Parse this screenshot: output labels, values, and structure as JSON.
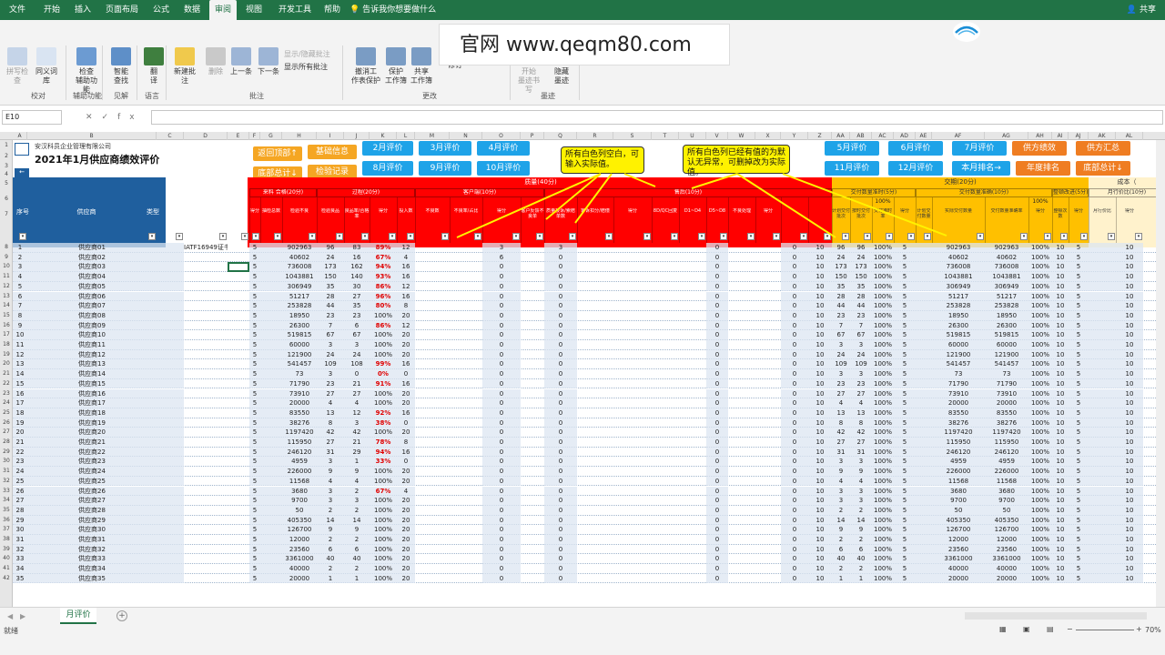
{
  "ribbon": {
    "tabs": [
      "文件",
      "开始",
      "插入",
      "页面布局",
      "公式",
      "数据",
      "审阅",
      "视图",
      "开发工具",
      "帮助"
    ],
    "active_tab": "审阅",
    "tell_me": "告诉我你想要做什么",
    "share": "共享",
    "buttons": {
      "spell": "拼写检查",
      "thesaurus": "同义词库",
      "check_assist": "检查\n辅助功能",
      "smart_lookup": "智能\n查找",
      "translate": "翻\n译",
      "new_comment": "新建批注",
      "delete": "删除",
      "prev": "上一条",
      "next": "下一条",
      "show_hide": "显示/隐藏批注",
      "show_all": "显示所有批注",
      "unprotect": "撤消工\n作表保护",
      "protect_wb": "保护\n工作簿",
      "share_wb": "共享\n工作簿",
      "allow_edit": "允许用户编辑区域",
      "track": "修订",
      "start_ink": "开始\n墨迹书写",
      "hide_ink": "隐藏\n墨迹"
    },
    "groups": {
      "proofing": "校对",
      "accessibility": "辅助功能",
      "insights": "见解",
      "language": "语言",
      "comments": "批注",
      "changes": "更改",
      "ink": "墨迹"
    }
  },
  "watermark": "官网  www.qeqm80.com",
  "formula_bar": {
    "name_box": "E10",
    "fx": "fx"
  },
  "columns": [
    "A",
    "B",
    "C",
    "D",
    "E",
    "F",
    "G",
    "H",
    "I",
    "J",
    "K",
    "L",
    "M",
    "N",
    "O",
    "P",
    "Q",
    "R",
    "S",
    "T",
    "U",
    "V",
    "W",
    "X",
    "Y",
    "Z",
    "AA",
    "AB",
    "AC",
    "AD",
    "AE",
    "AF",
    "AG",
    "AH",
    "AI",
    "AJ",
    "AK",
    "AL"
  ],
  "sheet": {
    "company": "安汉科员企业管理有限公司",
    "title": "2021年1月供应商绩效评价",
    "buttons_orange": [
      "返回顶部↑",
      "基础信息",
      "底部总计↓",
      "检验记录"
    ],
    "buttons_blue_left": [
      "2月评价",
      "3月评价",
      "4月评价",
      "8月评价",
      "9月评价",
      "10月评价"
    ],
    "buttons_blue_right": [
      "5月评价",
      "6月评价",
      "7月评价",
      "11月评价",
      "12月评价",
      "本月排名→"
    ],
    "buttons_orange_right": [
      "供方绩效",
      "供方汇总",
      "年度排名",
      "底部总计↓"
    ],
    "note1": "所有白色列空白，可输入实际值。",
    "note2": "所有白色列已经有值的为默认无异常，可删掉改为实际值。",
    "hdr_seq": "序号",
    "hdr_supplier": "供应商",
    "hdr_type": "类型",
    "hdr_quality": "质量(40分)",
    "hdr_delivery": "交期(20分)",
    "hdr_cost": "成本（",
    "sub_a": "来料 合格(20分)",
    "sub_b": "过程(20分)",
    "sub_c": "客户端(10分)",
    "sub_d": "售后(10分)",
    "sub_e": "交付数量准时(5分)",
    "sub_f": "交付数量准确(10分)",
    "sub_g": "整顿改进(5分)",
    "sub_h": "月行价比(10分)",
    "hdr_pct1": "100%",
    "hdr_pct2": "100%",
    "r6_cols": [
      "来料批次",
      "来料合格批",
      "得分",
      "抽检总数",
      "检验不良",
      "检验良品",
      "良品率/合格率",
      "得分",
      "投入数",
      "不良数",
      "不良率/占比",
      "得分",
      "客户反馈不良单",
      "质量投诉/索赔单数",
      "客诉扣分/赔偿",
      "得分",
      "8D/QC回复",
      "D1~D4",
      "D5~D8",
      "不良处理",
      "得分",
      "",
      "",
      "计划交付批次",
      "按时交付批次",
      "交付准时率",
      "得分",
      "计划交付数量",
      "实际交付数量",
      "交付数量准确率",
      "得分",
      "整顿次数",
      "得分",
      "月行价比",
      "得分"
    ],
    "rows": [
      {
        "n": "1",
        "name": "供应商01",
        "d": "IATF16949证书",
        "h": "902963",
        "i": "96",
        "j": "83",
        "k": "89%",
        "l": "12",
        "o": "3",
        "q": "3",
        "v": "0",
        "y": "0",
        "z": "10",
        "aa": "96",
        "ab": "96",
        "ac": "100%",
        "ad": "5",
        "ae": "902963",
        "af": "902963",
        "ag": "100%",
        "ah": "10",
        "aj": "5",
        "al": "10"
      },
      {
        "n": "2",
        "name": "供应商02",
        "h": "40602",
        "i": "24",
        "j": "16",
        "k": "67%",
        "l": "4",
        "o": "6",
        "q": "0",
        "v": "0",
        "y": "0",
        "z": "10",
        "aa": "24",
        "ab": "24",
        "ac": "100%",
        "ad": "5",
        "ae": "40602",
        "af": "40602",
        "ag": "100%",
        "ah": "10",
        "aj": "5",
        "al": "10"
      },
      {
        "n": "3",
        "name": "供应商03",
        "h": "736008",
        "i": "173",
        "j": "162",
        "k": "94%",
        "l": "16",
        "o": "0",
        "q": "0",
        "v": "0",
        "y": "0",
        "z": "10",
        "aa": "173",
        "ab": "173",
        "ac": "100%",
        "ad": "5",
        "ae": "736008",
        "af": "736008",
        "ag": "100%",
        "ah": "10",
        "aj": "5",
        "al": "10"
      },
      {
        "n": "4",
        "name": "供应商04",
        "h": "1043881",
        "i": "150",
        "j": "140",
        "k": "93%",
        "l": "16",
        "o": "0",
        "q": "0",
        "v": "0",
        "y": "0",
        "z": "10",
        "aa": "150",
        "ab": "150",
        "ac": "100%",
        "ad": "5",
        "ae": "1043881",
        "af": "1043881",
        "ag": "100%",
        "ah": "10",
        "aj": "5",
        "al": "10"
      },
      {
        "n": "5",
        "name": "供应商05",
        "h": "306949",
        "i": "35",
        "j": "30",
        "k": "86%",
        "l": "12",
        "o": "0",
        "q": "0",
        "v": "0",
        "y": "0",
        "z": "10",
        "aa": "35",
        "ab": "35",
        "ac": "100%",
        "ad": "5",
        "ae": "306949",
        "af": "306949",
        "ag": "100%",
        "ah": "10",
        "aj": "5",
        "al": "10"
      },
      {
        "n": "6",
        "name": "供应商06",
        "h": "51217",
        "i": "28",
        "j": "27",
        "k": "96%",
        "l": "16",
        "o": "0",
        "q": "0",
        "v": "0",
        "y": "0",
        "z": "10",
        "aa": "28",
        "ab": "28",
        "ac": "100%",
        "ad": "5",
        "ae": "51217",
        "af": "51217",
        "ag": "100%",
        "ah": "10",
        "aj": "5",
        "al": "10"
      },
      {
        "n": "7",
        "name": "供应商07",
        "h": "253828",
        "i": "44",
        "j": "35",
        "k": "80%",
        "l": "8",
        "o": "0",
        "q": "0",
        "v": "0",
        "y": "0",
        "z": "10",
        "aa": "44",
        "ab": "44",
        "ac": "100%",
        "ad": "5",
        "ae": "253828",
        "af": "253828",
        "ag": "100%",
        "ah": "10",
        "aj": "5",
        "al": "10"
      },
      {
        "n": "8",
        "name": "供应商08",
        "h": "18950",
        "i": "23",
        "j": "23",
        "k": "100%",
        "l": "20",
        "o": "0",
        "q": "0",
        "v": "0",
        "y": "0",
        "z": "10",
        "aa": "23",
        "ab": "23",
        "ac": "100%",
        "ad": "5",
        "ae": "18950",
        "af": "18950",
        "ag": "100%",
        "ah": "10",
        "aj": "5",
        "al": "10"
      },
      {
        "n": "9",
        "name": "供应商09",
        "h": "26300",
        "i": "7",
        "j": "6",
        "k": "86%",
        "l": "12",
        "o": "0",
        "q": "0",
        "v": "0",
        "y": "0",
        "z": "10",
        "aa": "7",
        "ab": "7",
        "ac": "100%",
        "ad": "5",
        "ae": "26300",
        "af": "26300",
        "ag": "100%",
        "ah": "10",
        "aj": "5",
        "al": "10"
      },
      {
        "n": "10",
        "name": "供应商10",
        "h": "519815",
        "i": "67",
        "j": "67",
        "k": "100%",
        "l": "20",
        "o": "0",
        "q": "0",
        "v": "0",
        "y": "0",
        "z": "10",
        "aa": "67",
        "ab": "67",
        "ac": "100%",
        "ad": "5",
        "ae": "519815",
        "af": "519815",
        "ag": "100%",
        "ah": "10",
        "aj": "5",
        "al": "10"
      },
      {
        "n": "11",
        "name": "供应商11",
        "h": "60000",
        "i": "3",
        "j": "3",
        "k": "100%",
        "l": "20",
        "o": "0",
        "q": "0",
        "v": "0",
        "y": "0",
        "z": "10",
        "aa": "3",
        "ab": "3",
        "ac": "100%",
        "ad": "5",
        "ae": "60000",
        "af": "60000",
        "ag": "100%",
        "ah": "10",
        "aj": "5",
        "al": "10"
      },
      {
        "n": "12",
        "name": "供应商12",
        "h": "121900",
        "i": "24",
        "j": "24",
        "k": "100%",
        "l": "20",
        "o": "0",
        "q": "0",
        "v": "0",
        "y": "0",
        "z": "10",
        "aa": "24",
        "ab": "24",
        "ac": "100%",
        "ad": "5",
        "ae": "121900",
        "af": "121900",
        "ag": "100%",
        "ah": "10",
        "aj": "5",
        "al": "10"
      },
      {
        "n": "13",
        "name": "供应商13",
        "h": "541457",
        "i": "109",
        "j": "108",
        "k": "99%",
        "l": "16",
        "o": "0",
        "q": "0",
        "v": "0",
        "y": "0",
        "z": "10",
        "aa": "109",
        "ab": "109",
        "ac": "100%",
        "ad": "5",
        "ae": "541457",
        "af": "541457",
        "ag": "100%",
        "ah": "10",
        "aj": "5",
        "al": "10"
      },
      {
        "n": "14",
        "name": "供应商14",
        "h": "73",
        "i": "3",
        "j": "0",
        "k": "0%",
        "l": "0",
        "o": "0",
        "q": "0",
        "v": "0",
        "y": "0",
        "z": "10",
        "aa": "3",
        "ab": "3",
        "ac": "100%",
        "ad": "5",
        "ae": "73",
        "af": "73",
        "ag": "100%",
        "ah": "10",
        "aj": "5",
        "al": "10"
      },
      {
        "n": "15",
        "name": "供应商15",
        "h": "71790",
        "i": "23",
        "j": "21",
        "k": "91%",
        "l": "16",
        "o": "0",
        "q": "0",
        "v": "0",
        "y": "0",
        "z": "10",
        "aa": "23",
        "ab": "23",
        "ac": "100%",
        "ad": "5",
        "ae": "71790",
        "af": "71790",
        "ag": "100%",
        "ah": "10",
        "aj": "5",
        "al": "10"
      },
      {
        "n": "16",
        "name": "供应商16",
        "h": "73910",
        "i": "27",
        "j": "27",
        "k": "100%",
        "l": "20",
        "o": "0",
        "q": "0",
        "v": "0",
        "y": "0",
        "z": "10",
        "aa": "27",
        "ab": "27",
        "ac": "100%",
        "ad": "5",
        "ae": "73910",
        "af": "73910",
        "ag": "100%",
        "ah": "10",
        "aj": "5",
        "al": "10"
      },
      {
        "n": "17",
        "name": "供应商17",
        "h": "20000",
        "i": "4",
        "j": "4",
        "k": "100%",
        "l": "20",
        "o": "0",
        "q": "0",
        "v": "0",
        "y": "0",
        "z": "10",
        "aa": "4",
        "ab": "4",
        "ac": "100%",
        "ad": "5",
        "ae": "20000",
        "af": "20000",
        "ag": "100%",
        "ah": "10",
        "aj": "5",
        "al": "10"
      },
      {
        "n": "18",
        "name": "供应商18",
        "h": "83550",
        "i": "13",
        "j": "12",
        "k": "92%",
        "l": "16",
        "o": "0",
        "q": "0",
        "v": "0",
        "y": "0",
        "z": "10",
        "aa": "13",
        "ab": "13",
        "ac": "100%",
        "ad": "5",
        "ae": "83550",
        "af": "83550",
        "ag": "100%",
        "ah": "10",
        "aj": "5",
        "al": "10"
      },
      {
        "n": "19",
        "name": "供应商19",
        "h": "38276",
        "i": "8",
        "j": "3",
        "k": "38%",
        "l": "0",
        "o": "0",
        "q": "0",
        "v": "0",
        "y": "0",
        "z": "10",
        "aa": "8",
        "ab": "8",
        "ac": "100%",
        "ad": "5",
        "ae": "38276",
        "af": "38276",
        "ag": "100%",
        "ah": "10",
        "aj": "5",
        "al": "10"
      },
      {
        "n": "20",
        "name": "供应商20",
        "h": "1197420",
        "i": "42",
        "j": "42",
        "k": "100%",
        "l": "20",
        "o": "0",
        "q": "0",
        "v": "0",
        "y": "0",
        "z": "10",
        "aa": "42",
        "ab": "42",
        "ac": "100%",
        "ad": "5",
        "ae": "1197420",
        "af": "1197420",
        "ag": "100%",
        "ah": "10",
        "aj": "5",
        "al": "10"
      },
      {
        "n": "21",
        "name": "供应商21",
        "h": "115950",
        "i": "27",
        "j": "21",
        "k": "78%",
        "l": "8",
        "o": "0",
        "q": "0",
        "v": "0",
        "y": "0",
        "z": "10",
        "aa": "27",
        "ab": "27",
        "ac": "100%",
        "ad": "5",
        "ae": "115950",
        "af": "115950",
        "ag": "100%",
        "ah": "10",
        "aj": "5",
        "al": "10"
      },
      {
        "n": "22",
        "name": "供应商22",
        "h": "246120",
        "i": "31",
        "j": "29",
        "k": "94%",
        "l": "16",
        "o": "0",
        "q": "0",
        "v": "0",
        "y": "0",
        "z": "10",
        "aa": "31",
        "ab": "31",
        "ac": "100%",
        "ad": "5",
        "ae": "246120",
        "af": "246120",
        "ag": "100%",
        "ah": "10",
        "aj": "5",
        "al": "10"
      },
      {
        "n": "23",
        "name": "供应商23",
        "h": "4959",
        "i": "3",
        "j": "1",
        "k": "33%",
        "l": "0",
        "o": "0",
        "q": "0",
        "v": "0",
        "y": "0",
        "z": "10",
        "aa": "3",
        "ab": "3",
        "ac": "100%",
        "ad": "5",
        "ae": "4959",
        "af": "4959",
        "ag": "100%",
        "ah": "10",
        "aj": "5",
        "al": "10"
      },
      {
        "n": "24",
        "name": "供应商24",
        "h": "226000",
        "i": "9",
        "j": "9",
        "k": "100%",
        "l": "20",
        "o": "0",
        "q": "0",
        "v": "0",
        "y": "0",
        "z": "10",
        "aa": "9",
        "ab": "9",
        "ac": "100%",
        "ad": "5",
        "ae": "226000",
        "af": "226000",
        "ag": "100%",
        "ah": "10",
        "aj": "5",
        "al": "10"
      },
      {
        "n": "25",
        "name": "供应商25",
        "h": "11568",
        "i": "4",
        "j": "4",
        "k": "100%",
        "l": "20",
        "o": "0",
        "q": "0",
        "v": "0",
        "y": "0",
        "z": "10",
        "aa": "4",
        "ab": "4",
        "ac": "100%",
        "ad": "5",
        "ae": "11568",
        "af": "11568",
        "ag": "100%",
        "ah": "10",
        "aj": "5",
        "al": "10"
      },
      {
        "n": "26",
        "name": "供应商26",
        "h": "3680",
        "i": "3",
        "j": "2",
        "k": "67%",
        "l": "4",
        "o": "0",
        "q": "0",
        "v": "0",
        "y": "0",
        "z": "10",
        "aa": "3",
        "ab": "3",
        "ac": "100%",
        "ad": "5",
        "ae": "3680",
        "af": "3680",
        "ag": "100%",
        "ah": "10",
        "aj": "5",
        "al": "10"
      },
      {
        "n": "27",
        "name": "供应商27",
        "h": "9700",
        "i": "3",
        "j": "3",
        "k": "100%",
        "l": "20",
        "o": "0",
        "q": "0",
        "v": "0",
        "y": "0",
        "z": "10",
        "aa": "3",
        "ab": "3",
        "ac": "100%",
        "ad": "5",
        "ae": "9700",
        "af": "9700",
        "ag": "100%",
        "ah": "10",
        "aj": "5",
        "al": "10"
      },
      {
        "n": "28",
        "name": "供应商28",
        "h": "50",
        "i": "2",
        "j": "2",
        "k": "100%",
        "l": "20",
        "o": "0",
        "q": "0",
        "v": "0",
        "y": "0",
        "z": "10",
        "aa": "2",
        "ab": "2",
        "ac": "100%",
        "ad": "5",
        "ae": "50",
        "af": "50",
        "ag": "100%",
        "ah": "10",
        "aj": "5",
        "al": "10"
      },
      {
        "n": "29",
        "name": "供应商29",
        "h": "405350",
        "i": "14",
        "j": "14",
        "k": "100%",
        "l": "20",
        "o": "0",
        "q": "0",
        "v": "0",
        "y": "0",
        "z": "10",
        "aa": "14",
        "ab": "14",
        "ac": "100%",
        "ad": "5",
        "ae": "405350",
        "af": "405350",
        "ag": "100%",
        "ah": "10",
        "aj": "5",
        "al": "10"
      },
      {
        "n": "30",
        "name": "供应商30",
        "h": "126700",
        "i": "9",
        "j": "9",
        "k": "100%",
        "l": "20",
        "o": "0",
        "q": "0",
        "v": "0",
        "y": "0",
        "z": "10",
        "aa": "9",
        "ab": "9",
        "ac": "100%",
        "ad": "5",
        "ae": "126700",
        "af": "126700",
        "ag": "100%",
        "ah": "10",
        "aj": "5",
        "al": "10"
      },
      {
        "n": "31",
        "name": "供应商31",
        "h": "12000",
        "i": "2",
        "j": "2",
        "k": "100%",
        "l": "20",
        "o": "0",
        "q": "0",
        "v": "0",
        "y": "0",
        "z": "10",
        "aa": "2",
        "ab": "2",
        "ac": "100%",
        "ad": "5",
        "ae": "12000",
        "af": "12000",
        "ag": "100%",
        "ah": "10",
        "aj": "5",
        "al": "10"
      },
      {
        "n": "32",
        "name": "供应商32",
        "h": "23560",
        "i": "6",
        "j": "6",
        "k": "100%",
        "l": "20",
        "o": "0",
        "q": "0",
        "v": "0",
        "y": "0",
        "z": "10",
        "aa": "6",
        "ab": "6",
        "ac": "100%",
        "ad": "5",
        "ae": "23560",
        "af": "23560",
        "ag": "100%",
        "ah": "10",
        "aj": "5",
        "al": "10"
      },
      {
        "n": "33",
        "name": "供应商33",
        "h": "3361000",
        "i": "40",
        "j": "40",
        "k": "100%",
        "l": "20",
        "o": "0",
        "q": "0",
        "v": "0",
        "y": "0",
        "z": "10",
        "aa": "40",
        "ab": "40",
        "ac": "100%",
        "ad": "5",
        "ae": "3361000",
        "af": "3361000",
        "ag": "100%",
        "ah": "10",
        "aj": "5",
        "al": "10"
      },
      {
        "n": "34",
        "name": "供应商34",
        "h": "40000",
        "i": "2",
        "j": "2",
        "k": "100%",
        "l": "20",
        "o": "0",
        "q": "0",
        "v": "0",
        "y": "0",
        "z": "10",
        "aa": "2",
        "ab": "2",
        "ac": "100%",
        "ad": "5",
        "ae": "40000",
        "af": "40000",
        "ag": "100%",
        "ah": "10",
        "aj": "5",
        "al": "10"
      },
      {
        "n": "35",
        "name": "供应商35",
        "h": "20000",
        "i": "1",
        "j": "1",
        "k": "100%",
        "l": "20",
        "o": "0",
        "q": "0",
        "v": "0",
        "y": "0",
        "z": "10",
        "aa": "1",
        "ab": "1",
        "ac": "100%",
        "ad": "5",
        "ae": "20000",
        "af": "20000",
        "ag": "100%",
        "ah": "10",
        "aj": "5",
        "al": "10"
      }
    ]
  },
  "sheet_tab": "月评价",
  "status": {
    "ready": "就绪",
    "zoom": "70%"
  },
  "colors": {
    "excel_green": "#217346",
    "header_red": "#ff0000",
    "header_orange": "#ffc000",
    "hdr_blue": "#1f5f9e",
    "row_blue": "#dce6f1"
  }
}
